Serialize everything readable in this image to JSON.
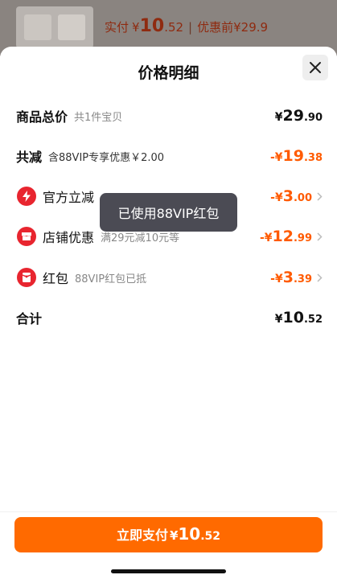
{
  "background": {
    "pay_label": "实付",
    "currency": "¥",
    "pay_int": "10",
    "pay_dec": ".52",
    "separator": "|",
    "before_label": "优惠前",
    "before_amount": "¥29.9"
  },
  "sheet": {
    "title": "价格明细",
    "close_icon": "close-icon"
  },
  "rows": {
    "total": {
      "label": "商品总价",
      "sub": "共1件宝贝",
      "currency": "¥",
      "int": "29",
      "dec": ".90"
    },
    "discount": {
      "label": "共减",
      "sub": "含88VIP专享优惠￥2.00",
      "sign": "-",
      "currency": "¥",
      "int": "19",
      "dec": ".38"
    },
    "official": {
      "label": "官方立减",
      "icon": "lightning-icon",
      "sign": "-",
      "currency": "¥",
      "int": "3",
      "dec": ".00"
    },
    "store": {
      "label": "店铺优惠",
      "sub": "满29元减10元等",
      "icon": "store-icon",
      "sign": "-",
      "currency": "¥",
      "int": "12",
      "dec": ".99"
    },
    "redpacket": {
      "label": "红包",
      "sub": "88VIP红包已抵",
      "icon": "red-packet-icon",
      "sign": "-",
      "currency": "¥",
      "int": "3",
      "dec": ".39"
    },
    "sum": {
      "label": "合计",
      "currency": "¥",
      "int": "10",
      "dec": ".52"
    }
  },
  "toast": {
    "text": "已使用88VIP红包"
  },
  "footer": {
    "pay_button_label": "立即支付",
    "currency": "¥",
    "int": "10",
    "dec": ".52"
  },
  "colors": {
    "accent": "#ff6a00",
    "discount": "#ff5a00",
    "badge": "#e8252f"
  }
}
